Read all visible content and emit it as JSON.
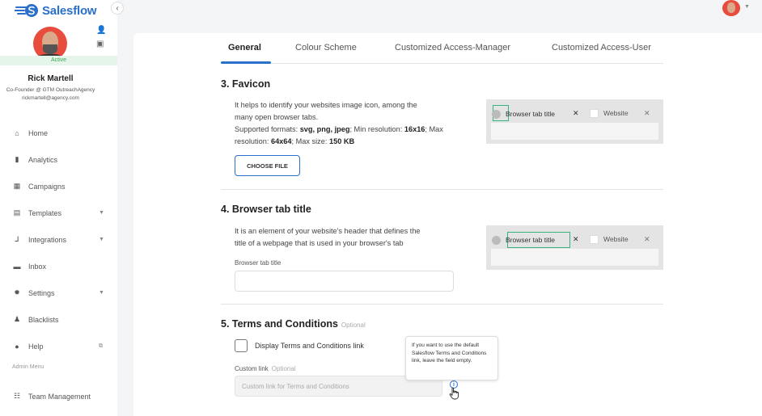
{
  "app": {
    "name": "Salesflow",
    "brand_color": "#2a6fc9"
  },
  "profile": {
    "status": "Active",
    "name": "Rick Martell",
    "role": "Co-Founder @ GTM OutreachAgency",
    "email": "rickmartell@agency.com"
  },
  "nav": {
    "items": [
      {
        "label": "Home",
        "icon": "home-icon",
        "glyph": "⌂"
      },
      {
        "label": "Analytics",
        "icon": "bar-chart-icon",
        "glyph": "▮"
      },
      {
        "label": "Campaigns",
        "icon": "grid-icon",
        "glyph": "▦"
      },
      {
        "label": "Templates",
        "icon": "message-icon",
        "glyph": "▤"
      },
      {
        "label": "Integrations",
        "icon": "integrations-icon",
        "glyph": "⅃"
      },
      {
        "label": "Inbox",
        "icon": "inbox-icon",
        "glyph": "▬"
      },
      {
        "label": "Settings",
        "icon": "gear-icon",
        "glyph": "✹"
      },
      {
        "label": "Blacklists",
        "icon": "user-block-icon",
        "glyph": "♟"
      },
      {
        "label": "Help",
        "icon": "help-icon",
        "glyph": "●"
      }
    ],
    "admin_label": "Admin Menu",
    "team_label": "Team Management",
    "team_glyph": "☷"
  },
  "tabs": [
    "General",
    "Colour Scheme",
    "Customized Access-Manager",
    "Customized Access-User"
  ],
  "favicon": {
    "title": "3.  Favicon",
    "desc_line1": "It helps to identify your websites image icon, among the",
    "desc_line2": "many open browser tabs.",
    "supported_label": "Supported formats: ",
    "formats": "svg, png, jpeg",
    "min_res_label": "; Min resolution: ",
    "min_res": "16x16",
    "max_label": "; Max",
    "res_label": "resolution: ",
    "max_res": "64x64",
    "size_label": "; Max size: ",
    "max_size": "150 KB",
    "button": "CHOOSE FILE"
  },
  "browser_tab": {
    "title": "4.  Browser tab title",
    "desc_line1": "It is an element of your website's header that defines the",
    "desc_line2": "title of a webpage that is used in your browser's tab",
    "field_label": "Browser tab title",
    "value": ""
  },
  "preview": {
    "tab_title": "Browser tab title",
    "close": "✕",
    "website": "Website"
  },
  "terms": {
    "title": "5.  Terms and Conditions",
    "optional": "Optional",
    "checkbox_label": "Display Terms and Conditions link",
    "field_label": "Custom link",
    "field_optional": "Optional",
    "placeholder": "Custom link for Terms and Conditions",
    "tooltip": "If you want to use the default Salesflow Terms and Conditions link, leave the field empty."
  }
}
